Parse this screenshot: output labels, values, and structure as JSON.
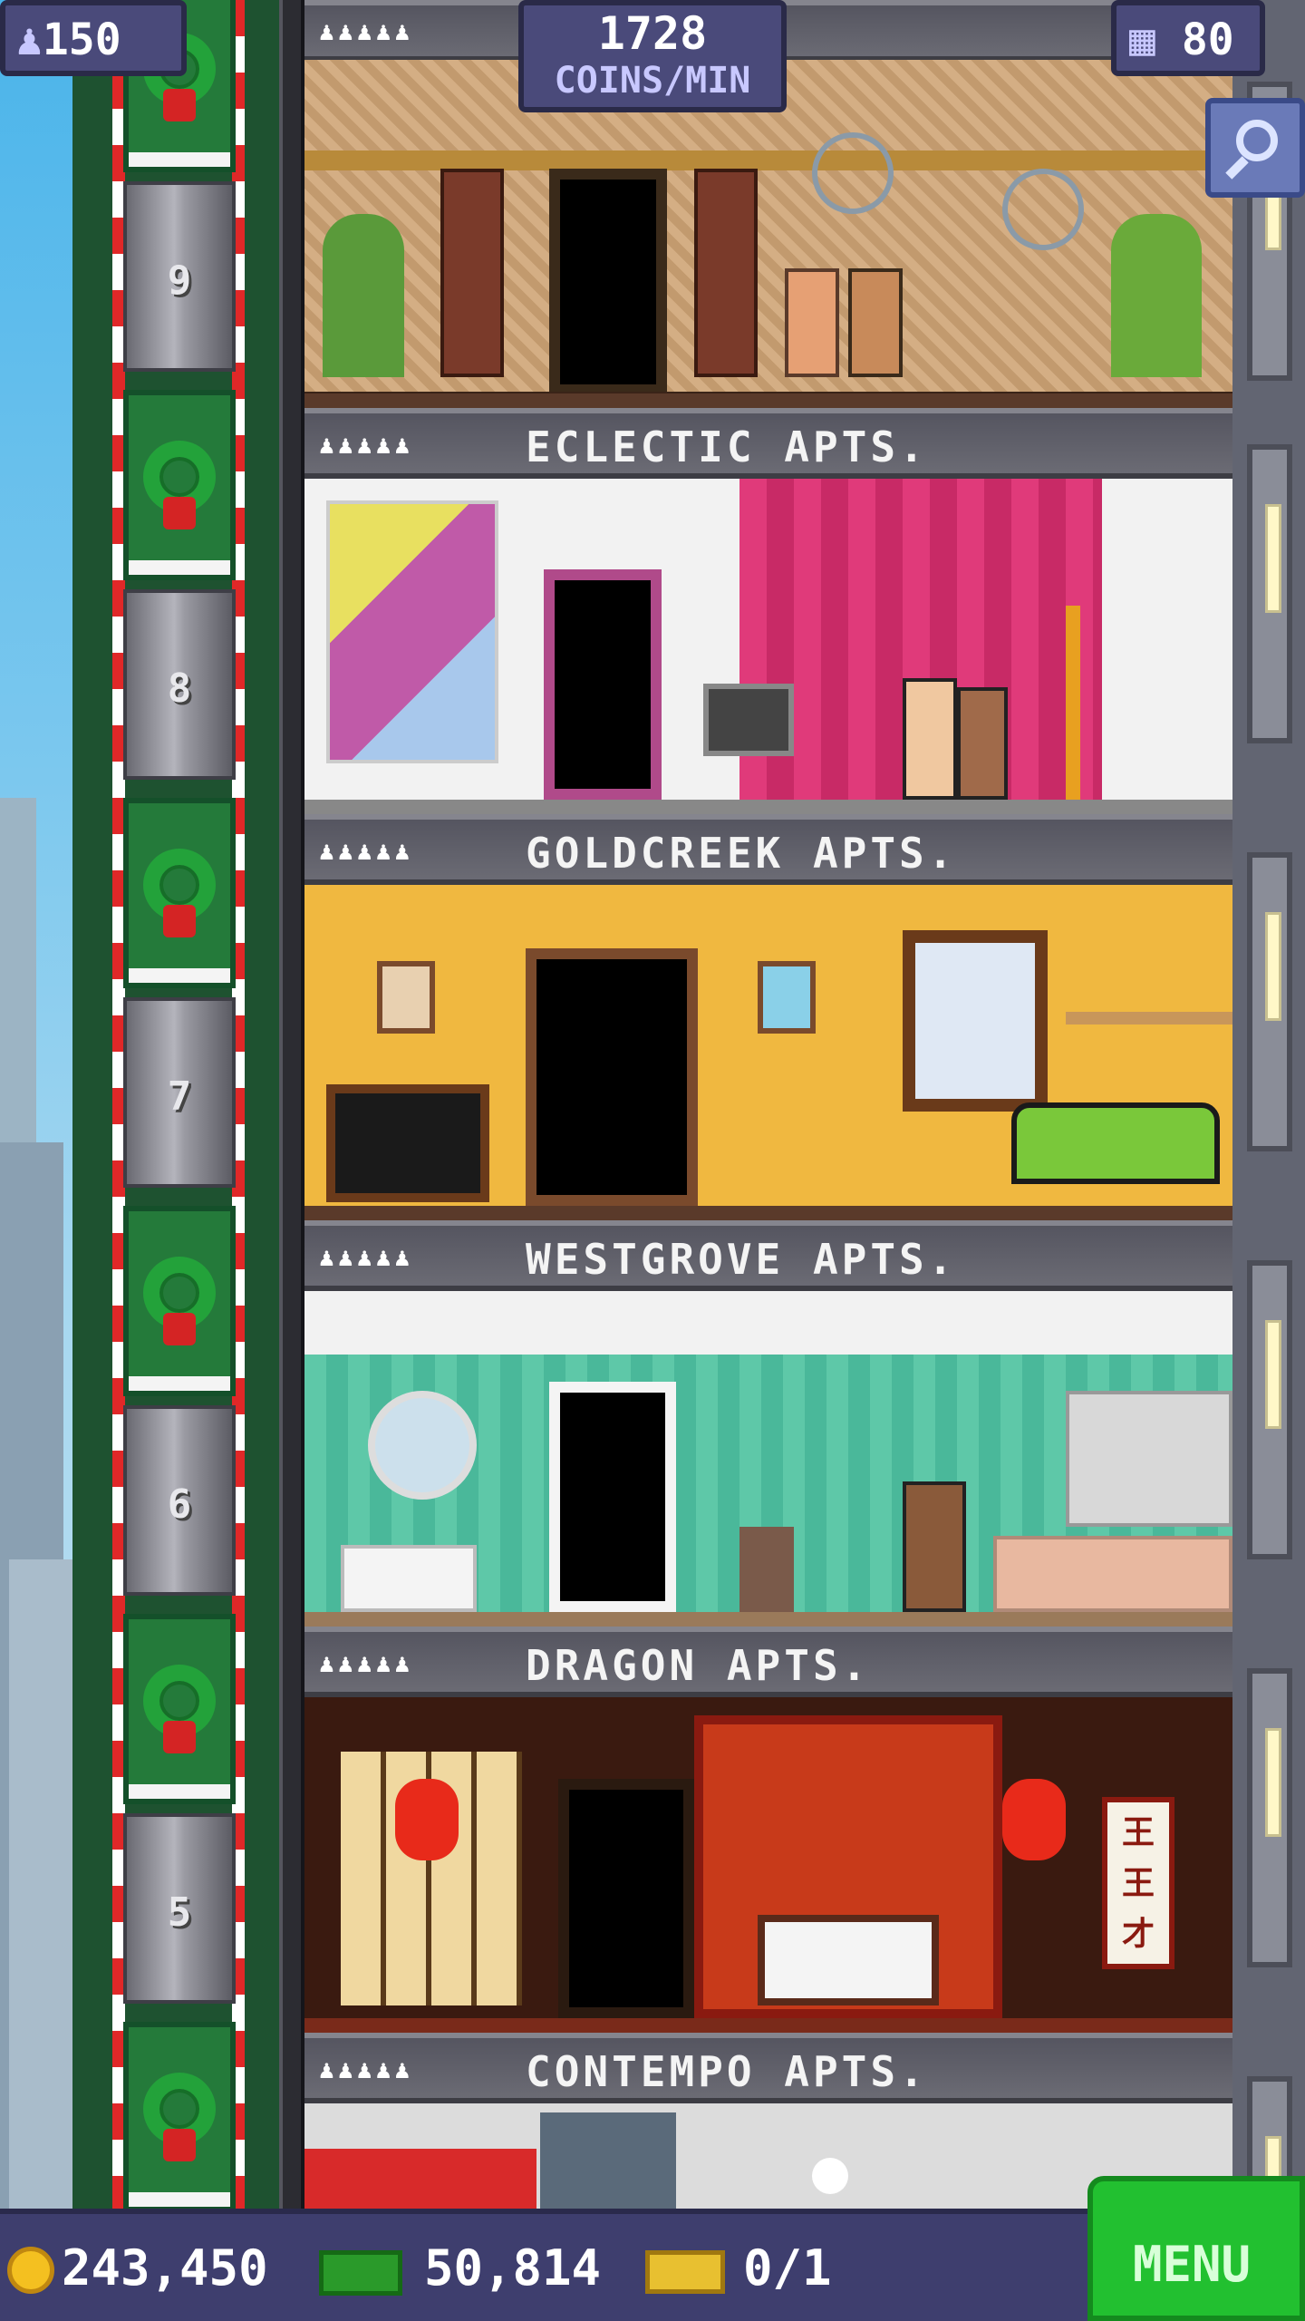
{
  "hud": {
    "population": "150",
    "coins_per_min_value": "1728",
    "coins_per_min_unit": "COINS/MIN",
    "floor_count": "80"
  },
  "bottom_bar": {
    "coins": "243,450",
    "bux": "50,814",
    "tickets": "0/1",
    "menu_label": "MENU"
  },
  "elevator_floor_numbers": [
    "9",
    "8",
    "7",
    "6",
    "5"
  ],
  "floors": [
    {
      "name": "ECLECTIC APTS."
    },
    {
      "name": "GOLDCREEK APTS."
    },
    {
      "name": "WESTGROVE APTS."
    },
    {
      "name": "DRAGON APTS."
    },
    {
      "name": "CONTEMPO APTS."
    }
  ],
  "dragon_scroll_text": "王王才",
  "icons": {
    "population": "person-up-icon",
    "floors": "building-grid-icon",
    "zoom": "magnifier-icon",
    "coin": "coin-icon",
    "bux": "cash-bill-icon",
    "ticket": "golden-ticket-icon"
  },
  "colors": {
    "hud_panel": "#4a4a7a",
    "menu_green": "#22c030",
    "elevator_green": "#247a3a",
    "stripe_red": "#e02828"
  }
}
